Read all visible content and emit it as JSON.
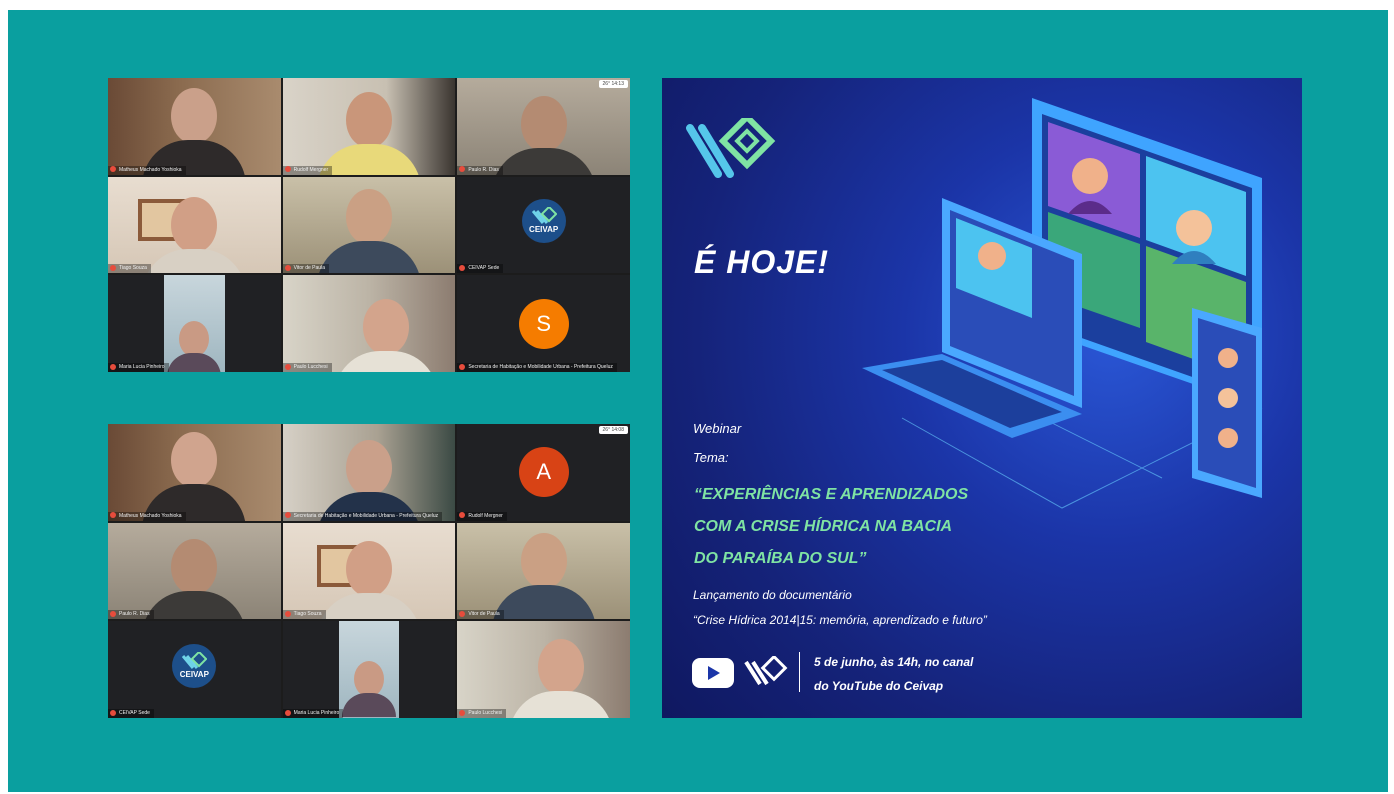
{
  "grid1": {
    "tiles": [
      {
        "name": "Matheus Machado Yoshioka",
        "clock": ""
      },
      {
        "name": "Rudolf Mergner",
        "clock": ""
      },
      {
        "name": "Paulo R. Dias",
        "clock": "26° 14:13"
      },
      {
        "name": "Tiago Souza",
        "clock": ""
      },
      {
        "name": "Vitor de Paula",
        "clock": ""
      },
      {
        "name": "CEIVAP Sede",
        "clock": ""
      },
      {
        "name": "Maria Lucia Pinheiro",
        "clock": ""
      },
      {
        "name": "Paulo Lucchesi",
        "clock": ""
      },
      {
        "name": "Secretaria de Habitação e Mobilidade Urbana - Prefeitura Queluz",
        "clock": ""
      }
    ],
    "avatar_letter": "S",
    "logo_text": "CEIVAP"
  },
  "grid2": {
    "tiles": [
      {
        "name": "Matheus Machado Yoshioka",
        "clock": ""
      },
      {
        "name": "Secretaria de Habitação e Mobilidade Urbana - Prefeitura Queluz",
        "clock": ""
      },
      {
        "name": "Rudolf Mergner",
        "clock": "26° 14:08"
      },
      {
        "name": "Paulo R. Dias",
        "clock": ""
      },
      {
        "name": "Tiago Souza",
        "clock": ""
      },
      {
        "name": "Vitor de Paula",
        "clock": ""
      },
      {
        "name": "CEIVAP Sede",
        "clock": ""
      },
      {
        "name": "Maria Lucia Pinheiro",
        "clock": ""
      },
      {
        "name": "Paulo Lucchesi",
        "clock": ""
      }
    ],
    "avatar_letter": "A",
    "logo_text": "CEIVAP"
  },
  "poster": {
    "headline": "É HOJE!",
    "webinar": "Webinar",
    "tema": "Tema:",
    "quote_lines": [
      "“EXPERIÊNCIAS E APRENDIZADOS",
      "COM A CRISE HÍDRICA NA BACIA",
      "DO PARAÍBA DO SUL”"
    ],
    "launch": "Lançamento do documentário",
    "doc_title": "“Crise Hídrica 2014|15: memória, aprendizado e futuro”",
    "date_line1": "5 de junho, às 14h, no canal",
    "date_line2": "do YouTube do Ceivap"
  },
  "colors": {
    "background": "#0a9f9f",
    "poster_blue": "#1b35a8",
    "accent_green": "#7fe3a3",
    "avatar_orange": "#f57c00",
    "avatar_red": "#d84315"
  }
}
